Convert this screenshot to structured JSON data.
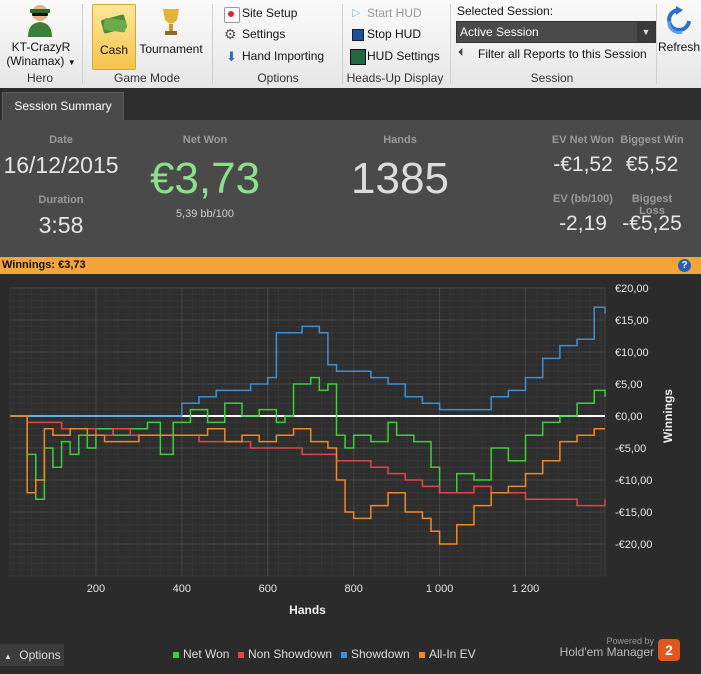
{
  "ribbon": {
    "hero": {
      "name": "KT-CrazyR",
      "site": "(Winamax)",
      "group_label": "Hero"
    },
    "game_mode": {
      "cash_label": "Cash",
      "tournament_label": "Tournament",
      "group_label": "Game Mode"
    },
    "options": {
      "site_setup_label": "Site Setup",
      "settings_label": "Settings",
      "hand_importing_label": "Hand Importing",
      "group_label": "Options"
    },
    "hud": {
      "start_label": "Start HUD",
      "stop_label": "Stop HUD",
      "settings_label": "HUD Settings",
      "group_label": "Heads-Up Display"
    },
    "session": {
      "selected_label": "Selected Session:",
      "selected_value": "Active Session",
      "filter_label": "Filter all Reports to this Session",
      "group_label": "Session"
    },
    "refresh_label": "Refresh"
  },
  "tabs": [
    {
      "label": "Session Summary"
    }
  ],
  "summary": {
    "date_label": "Date",
    "date_value": "16/12/2015",
    "duration_label": "Duration",
    "duration_value": "3:58",
    "net_won_label": "Net Won",
    "net_won_value": "€3,73",
    "bb100_value": "5,39 bb/100",
    "hands_label": "Hands",
    "hands_value": "1385",
    "ev_net_won_label": "EV Net Won",
    "ev_net_won_value": "-€1,52",
    "biggest_win_label": "Biggest Win",
    "biggest_win_value": "€5,52",
    "ev_bb100_label": "EV (bb/100)",
    "ev_bb100_value": "-2,19",
    "biggest_loss_label": "Biggest Loss",
    "biggest_loss_value": "-€5,25"
  },
  "winnings_bar": {
    "label": "Winnings:",
    "value": "€3,73",
    "help_icon": "question-icon"
  },
  "footer": {
    "options_label": "Options",
    "powered_by": "Powered by",
    "brand": "Hold'em Manager",
    "brand_badge": "2"
  },
  "colors": {
    "net_won": "#3ad13a",
    "non_showdown": "#e04848",
    "showdown": "#3f8fd6",
    "all_in_ev": "#f08a24",
    "accent_orange": "#f3a43a"
  },
  "chart_data": {
    "type": "line",
    "xlabel": "Hands",
    "ylabel": "Winnings",
    "xlim": [
      0,
      1385
    ],
    "ylim": [
      -25,
      20
    ],
    "x_ticks": [
      200,
      400,
      600,
      800,
      1000,
      1200
    ],
    "x_tick_labels": [
      "200",
      "400",
      "600",
      "800",
      "1 000",
      "1 200"
    ],
    "y_ticks": [
      20,
      15,
      10,
      5,
      0,
      -5,
      -10,
      -15,
      -20
    ],
    "y_tick_labels": [
      "€20,00",
      "€15,00",
      "€10,00",
      "€5,00",
      "€0,00",
      "-€5,00",
      "-€10,00",
      "-€15,00",
      "-€20,00"
    ],
    "grid": true,
    "legend_position": "bottom",
    "series": [
      {
        "name": "Net Won",
        "color": "#3ad13a",
        "x": [
          0,
          40,
          60,
          80,
          100,
          120,
          140,
          160,
          180,
          200,
          240,
          280,
          320,
          350,
          380,
          420,
          460,
          500,
          540,
          580,
          620,
          640,
          660,
          700,
          720,
          740,
          760,
          780,
          800,
          840,
          880,
          900,
          940,
          980,
          1000,
          1040,
          1080,
          1120,
          1160,
          1200,
          1240,
          1280,
          1320,
          1360,
          1385
        ],
        "y": [
          0,
          -6,
          -13,
          -5,
          -8,
          -4,
          -6,
          -3,
          -5,
          -2,
          -3,
          -2,
          -1,
          -6,
          -1,
          1,
          -1,
          2,
          0,
          1,
          -1,
          0,
          5,
          6,
          4,
          5,
          -3,
          -5,
          -3,
          -4,
          -1,
          -3,
          -4,
          -8,
          -12,
          -9,
          -10,
          -5,
          -7,
          -3,
          -1,
          0,
          2,
          4,
          3
        ]
      },
      {
        "name": "Non Showdown",
        "color": "#e04848",
        "x": [
          0,
          40,
          80,
          120,
          160,
          200,
          240,
          280,
          320,
          360,
          400,
          440,
          480,
          520,
          560,
          600,
          640,
          680,
          720,
          760,
          800,
          840,
          880,
          920,
          960,
          1000,
          1040,
          1080,
          1120,
          1160,
          1200,
          1240,
          1280,
          1320,
          1360,
          1385
        ],
        "y": [
          0,
          -1,
          -1,
          -2,
          -2,
          -3,
          -2,
          -3,
          -3,
          -3,
          -3,
          -4,
          -4,
          -4,
          -5,
          -5,
          -5,
          -6,
          -6,
          -7,
          -7,
          -8,
          -9,
          -10,
          -11,
          -12,
          -12,
          -11,
          -12,
          -12,
          -13,
          -13,
          -13,
          -14,
          -14,
          -13
        ]
      },
      {
        "name": "Showdown",
        "color": "#3f8fd6",
        "x": [
          0,
          40,
          80,
          120,
          160,
          200,
          240,
          280,
          320,
          360,
          400,
          440,
          480,
          520,
          560,
          600,
          620,
          640,
          680,
          720,
          740,
          760,
          800,
          840,
          880,
          920,
          960,
          1000,
          1040,
          1080,
          1120,
          1160,
          1200,
          1240,
          1280,
          1320,
          1360,
          1385
        ],
        "y": [
          0,
          0,
          0,
          0,
          0,
          0,
          0,
          0,
          0,
          0,
          2,
          3,
          4,
          4,
          5,
          6,
          13,
          13,
          14,
          13,
          8,
          7,
          7,
          6,
          5,
          3,
          2,
          1,
          1,
          1,
          3,
          4,
          6,
          9,
          11,
          12,
          17,
          16
        ]
      },
      {
        "name": "All-In EV",
        "color": "#f08a24",
        "x": [
          0,
          40,
          60,
          80,
          100,
          140,
          180,
          220,
          260,
          300,
          340,
          380,
          420,
          460,
          500,
          540,
          580,
          620,
          660,
          700,
          740,
          760,
          780,
          800,
          840,
          880,
          920,
          960,
          980,
          1000,
          1040,
          1080,
          1120,
          1160,
          1200,
          1240,
          1280,
          1320,
          1360,
          1385
        ],
        "y": [
          0,
          -12,
          -10,
          -2,
          -3,
          -2,
          -3,
          -4,
          -4,
          -3,
          -3,
          -3,
          -3,
          -2,
          -4,
          -3,
          -4,
          -3,
          -2,
          -4,
          -5,
          -10,
          -15,
          -16,
          -14,
          -12,
          -15,
          -16,
          -18,
          -20,
          -17,
          -14,
          -12,
          -11,
          -9,
          -7,
          -4,
          -3,
          -2,
          -2
        ]
      }
    ]
  }
}
